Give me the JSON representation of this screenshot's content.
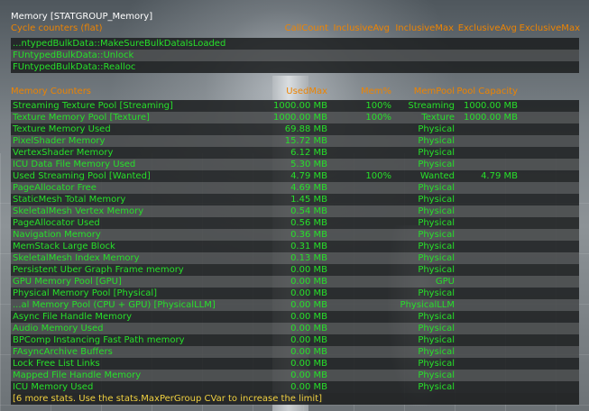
{
  "title": "Memory [STATGROUP_Memory]",
  "cycle_section": {
    "heading": "Cycle counters (flat)",
    "columns": [
      "CallCount",
      "InclusiveAvg",
      "InclusiveMax",
      "ExclusiveAvg",
      "ExclusiveMax"
    ],
    "rows": [
      "...ntypedBulkData::MakeSureBulkDataIsLoaded",
      "FUntypedBulkData::Unlock",
      "FUntypedBulkData::Realloc"
    ]
  },
  "memory_section": {
    "heading": "Memory Counters",
    "columns": {
      "used_max": "UsedMax",
      "mem_pct": "Mem%",
      "mempool": "MemPool",
      "pool_capacity": "Pool Capacity"
    },
    "rows": [
      {
        "name": "Streaming Texture Pool [Streaming]",
        "used": "1000.00 MB",
        "pct": "100%",
        "pool": "Streaming",
        "cap": "1000.00 MB"
      },
      {
        "name": "Texture Memory Pool [Texture]",
        "used": "1000.00 MB",
        "pct": "100%",
        "pool": "Texture",
        "cap": "1000.00 MB"
      },
      {
        "name": "Texture Memory Used",
        "used": "69.88 MB",
        "pct": "",
        "pool": "Physical",
        "cap": ""
      },
      {
        "name": "PixelShader Memory",
        "used": "15.72 MB",
        "pct": "",
        "pool": "Physical",
        "cap": ""
      },
      {
        "name": "VertexShader Memory",
        "used": "6.12 MB",
        "pct": "",
        "pool": "Physical",
        "cap": ""
      },
      {
        "name": "ICU Data File Memory Used",
        "used": "5.30 MB",
        "pct": "",
        "pool": "Physical",
        "cap": ""
      },
      {
        "name": "Used Streaming Pool [Wanted]",
        "used": "4.79 MB",
        "pct": "100%",
        "pool": "Wanted",
        "cap": "4.79 MB"
      },
      {
        "name": "PageAllocator Free",
        "used": "4.69 MB",
        "pct": "",
        "pool": "Physical",
        "cap": ""
      },
      {
        "name": "StaticMesh Total Memory",
        "used": "1.45 MB",
        "pct": "",
        "pool": "Physical",
        "cap": ""
      },
      {
        "name": "SkeletalMesh Vertex Memory",
        "used": "0.54 MB",
        "pct": "",
        "pool": "Physical",
        "cap": ""
      },
      {
        "name": "PageAllocator Used",
        "used": "0.56 MB",
        "pct": "",
        "pool": "Physical",
        "cap": ""
      },
      {
        "name": "Navigation Memory",
        "used": "0.36 MB",
        "pct": "",
        "pool": "Physical",
        "cap": ""
      },
      {
        "name": "MemStack Large Block",
        "used": "0.31 MB",
        "pct": "",
        "pool": "Physical",
        "cap": ""
      },
      {
        "name": "SkeletalMesh Index Memory",
        "used": "0.13 MB",
        "pct": "",
        "pool": "Physical",
        "cap": ""
      },
      {
        "name": "Persistent Uber Graph Frame memory",
        "used": "0.00 MB",
        "pct": "",
        "pool": "Physical",
        "cap": ""
      },
      {
        "name": "GPU Memory Pool [GPU]",
        "used": "0.00 MB",
        "pct": "",
        "pool": "GPU",
        "cap": ""
      },
      {
        "name": "Physical Memory Pool [Physical]",
        "used": "0.00 MB",
        "pct": "",
        "pool": "Physical",
        "cap": ""
      },
      {
        "name": "...al Memory Pool (CPU + GPU) [PhysicalLLM]",
        "used": "0.00 MB",
        "pct": "",
        "pool": "PhysicalLLM",
        "cap": ""
      },
      {
        "name": "Async File Handle Memory",
        "used": "0.00 MB",
        "pct": "",
        "pool": "Physical",
        "cap": ""
      },
      {
        "name": "Audio Memory Used",
        "used": "0.00 MB",
        "pct": "",
        "pool": "Physical",
        "cap": ""
      },
      {
        "name": "BPComp Instancing Fast Path memory",
        "used": "0.00 MB",
        "pct": "",
        "pool": "Physical",
        "cap": ""
      },
      {
        "name": "FAsyncArchive Buffers",
        "used": "0.00 MB",
        "pct": "",
        "pool": "Physical",
        "cap": ""
      },
      {
        "name": "Lock Free List Links",
        "used": "0.00 MB",
        "pct": "",
        "pool": "Physical",
        "cap": ""
      },
      {
        "name": "Mapped File Handle Memory",
        "used": "0.00 MB",
        "pct": "",
        "pool": "Physical",
        "cap": ""
      },
      {
        "name": "ICU Memory Used",
        "used": "0.00 MB",
        "pct": "",
        "pool": "Physical",
        "cap": ""
      }
    ],
    "footer": "[6 more stats. Use the stats.MaxPerGroup CVar to increase the limit]"
  },
  "colors": {
    "title": "#ffffff",
    "header": "#ee8400",
    "value_text": "#27e02a",
    "footer_text": "#f0d040"
  }
}
